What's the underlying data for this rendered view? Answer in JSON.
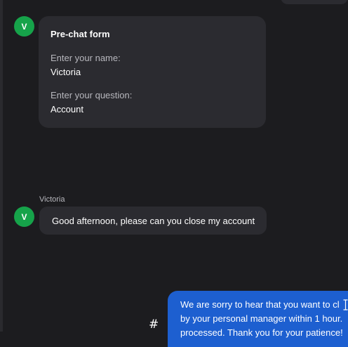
{
  "avatars": {
    "initial": "V"
  },
  "prechat_form": {
    "title": "Pre-chat form",
    "fields": [
      {
        "label": "Enter your name:",
        "value": "Victoria"
      },
      {
        "label": "Enter your question:",
        "value": "Account"
      }
    ]
  },
  "customer_message": {
    "sender": "Victoria",
    "text": "Good afternoon, please can you close my account"
  },
  "composer": {
    "hash_symbol": "#"
  },
  "agent_message": {
    "lines": [
      "We are sorry to hear that you want to cl",
      "by your personal manager within 1 hour.",
      "processed. Thank you for your patience!"
    ]
  },
  "colors": {
    "background": "#1c1c1f",
    "bubble_incoming": "#2b2b30",
    "bubble_outgoing": "#1d5fd0",
    "avatar": "#16a34a"
  }
}
